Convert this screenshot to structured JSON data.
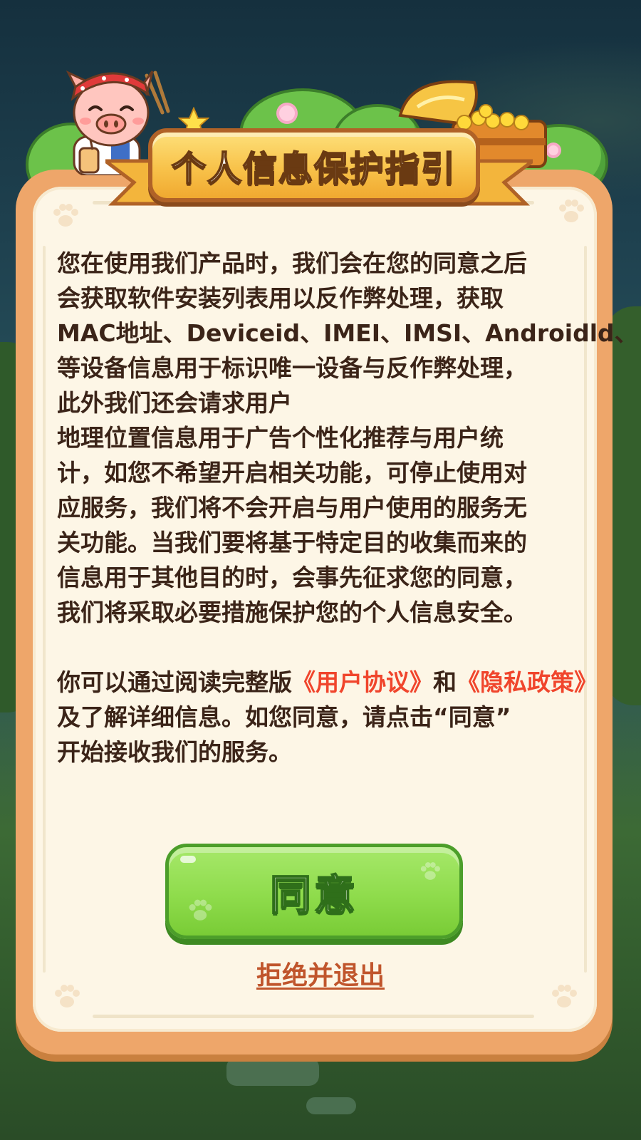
{
  "dialog": {
    "title": "个人信息保护指引",
    "paragraph1_lines": [
      "您在使用我们产品时，我们会在您的同意之后",
      "会获取软件安装列表用以反作弊处理，获取",
      "MAC地址、Deviceid、IMEI、IMSI、Androidld、",
      "等设备信息用于标识唯一设备与反作弊处理，",
      "此外我们还会请求用户",
      "地理位置信息用于广告个性化推荐与用户统",
      "计，如您不希望开启相关功能，可停止使用对",
      "应服务，我们将不会开启与用户使用的服务无",
      "关功能。当我们要将基于特定目的收集而来的",
      "信息用于其他目的时，会事先征求您的同意，",
      "我们将采取必要措施保护您的个人信息安全。"
    ],
    "paragraph2": {
      "prefix": "你可以通过阅读完整版",
      "user_agreement_link": "《用户协议》",
      "conjunction": "和",
      "privacy_policy_link": "《隐私政策》",
      "line2": "及了解详细信息。如您同意，请点击“同意”",
      "line3": "开始接收我们的服务。"
    },
    "agree_button_label": "同意",
    "reject_link_label": "拒绝并退出"
  },
  "colors": {
    "panel_border": "#eea66a",
    "panel_fill": "#fdf6e6",
    "body_text": "#3b2418",
    "link": "#f0452c",
    "agree_button": "#8fdc4c",
    "reject_link": "#c0552c",
    "banner": "#f8c24a"
  },
  "icons": {
    "mascot": "pig-mascot-icon",
    "chest": "treasure-chest-icon",
    "paw": "paw-print-icon",
    "star": "star-icon",
    "flower": "flower-icon"
  }
}
